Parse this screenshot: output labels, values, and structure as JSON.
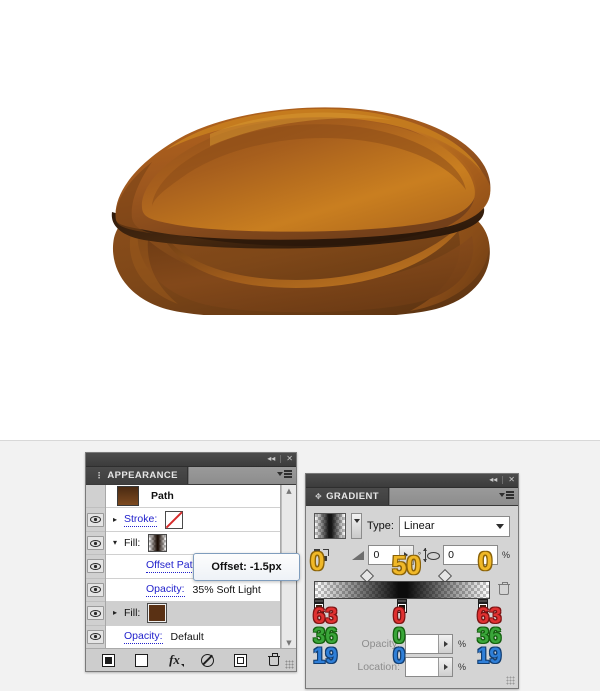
{
  "artwork": {
    "name": "nut-illustration",
    "description": "Brown nut / hazelnut shape with gradient shading",
    "colors": {
      "top_shell_light": "#b5651d",
      "top_shell_mid": "#9a5520",
      "top_shell_dark": "#6f3a14",
      "highlight": "#c87a1e",
      "crack_dark": "#3a2110",
      "bottom_shell": "#8b4f1c",
      "bottom_shell_dark": "#5d3412",
      "background": "#ffffff"
    }
  },
  "appearance_panel": {
    "tab_label": "APPEARANCE",
    "header_item": "Path",
    "rows": [
      {
        "label": "Stroke:",
        "value": "",
        "swatch": "none-swatch",
        "twirl": "collapsed",
        "link": true
      },
      {
        "label": "Fill:",
        "value": "",
        "swatch": "gradient-swatch",
        "twirl": "expanded",
        "link": false
      },
      {
        "label": "Offset Path",
        "value": "",
        "swatch": "",
        "twirl": "none",
        "link": true
      },
      {
        "label": "Opacity:",
        "value": "35% Soft Light",
        "swatch": "",
        "twirl": "none",
        "link": true
      },
      {
        "label": "Fill:",
        "value": "",
        "swatch": "brown-swatch",
        "twirl": "collapsed",
        "link": false
      },
      {
        "label": "Opacity:",
        "value": "Default",
        "swatch": "",
        "twirl": "none",
        "link": true
      }
    ],
    "footer_buttons": [
      "add-new-stroke-button",
      "add-new-fill-button",
      "add-new-effect-button",
      "clear-appearance-button",
      "duplicate-item-button",
      "delete-item-button"
    ]
  },
  "tooltip": {
    "text": "Offset: -1.5px"
  },
  "gradient_panel": {
    "tab_label": "GRADIENT",
    "type_label": "Type:",
    "type_value": "Linear",
    "angle_value": "0",
    "angle_unit": "°",
    "aspect_value": "0",
    "aspect_unit": "%",
    "opacity_label": "Opacity:",
    "opacity_value": "",
    "opacity_unit": "%",
    "location_label": "Location:",
    "location_value": "",
    "location_unit": "%",
    "stop_colors": [
      "#3a2110",
      "#140d06",
      "#3a2110"
    ]
  },
  "annotations": {
    "left_reverse_zero": "0",
    "angle_fifty": "50",
    "aspect_zero": "0",
    "left_rgb": {
      "r": "63",
      "g": "36",
      "b": "19"
    },
    "center_rgb": {
      "r": "0",
      "g": "0",
      "b": "0"
    },
    "right_rgb": {
      "r": "63",
      "g": "36",
      "b": "19"
    }
  }
}
